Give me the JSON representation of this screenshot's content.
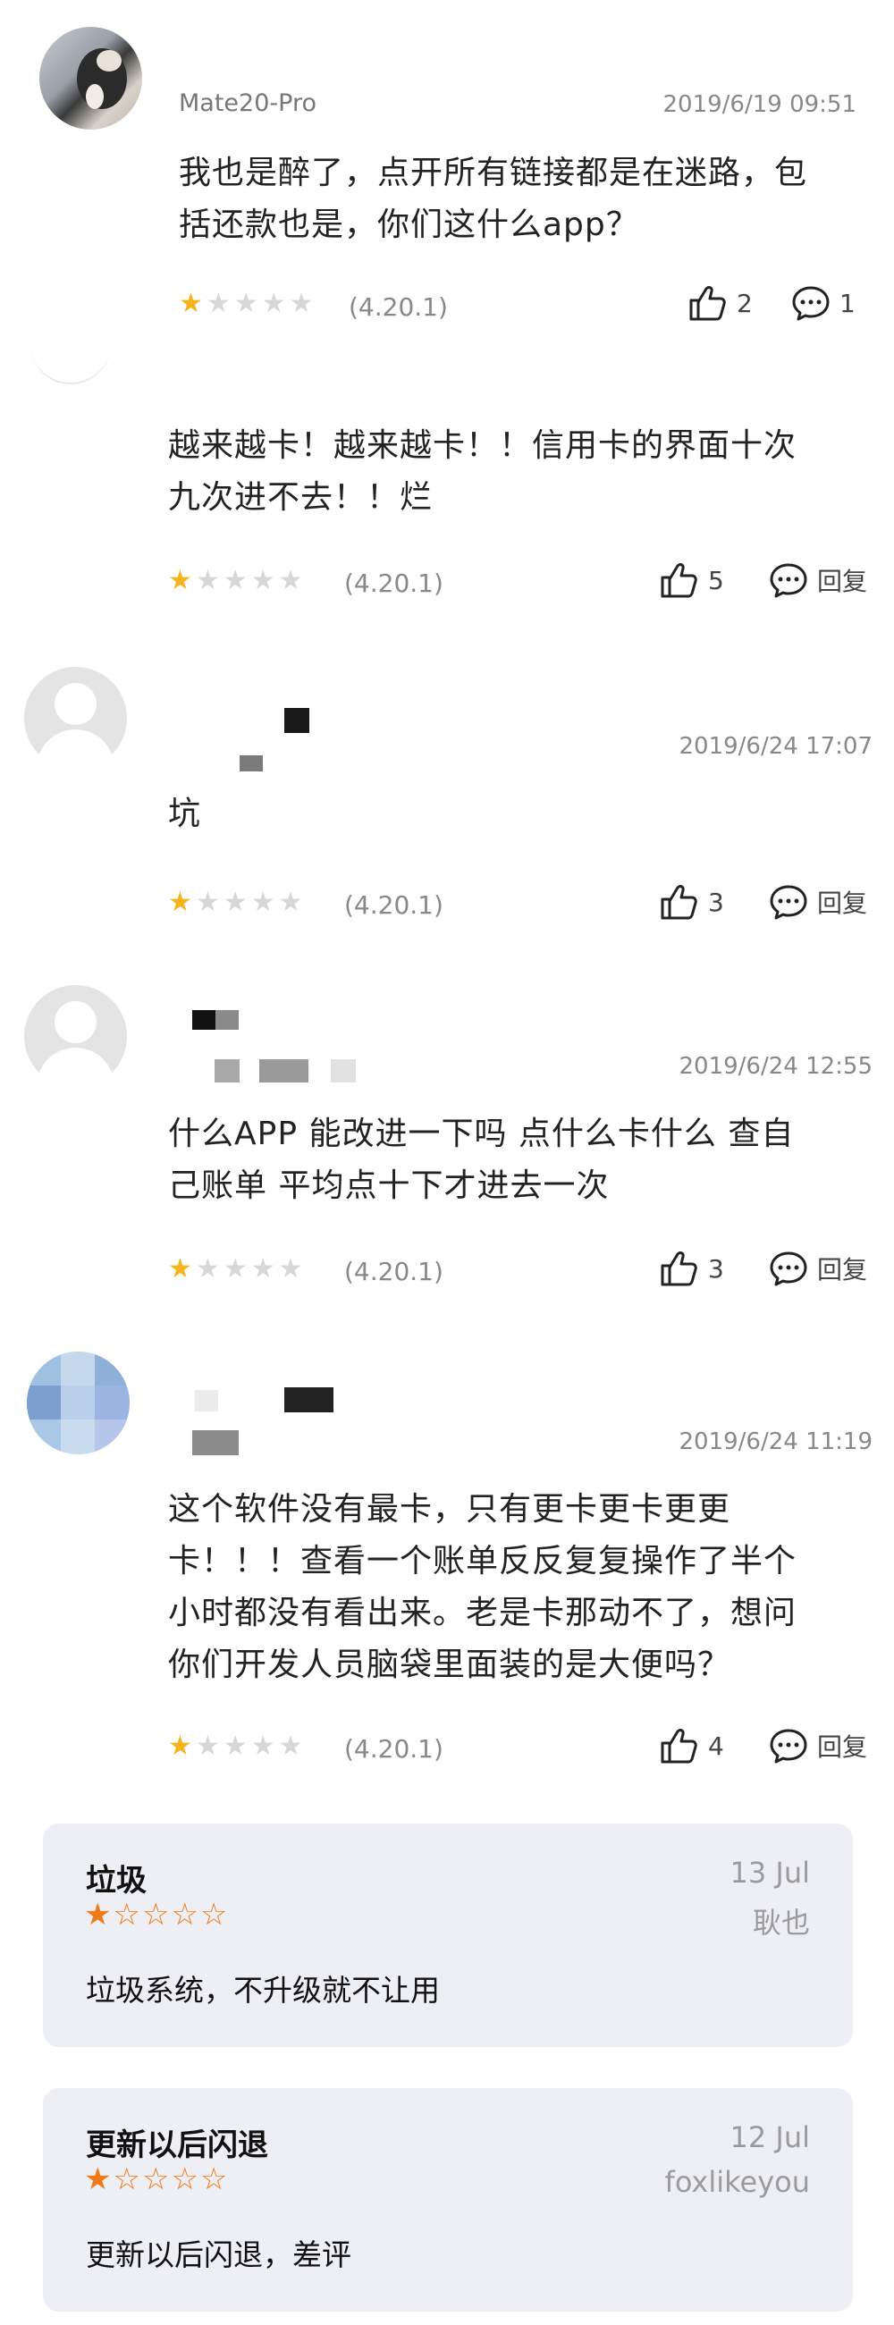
{
  "reviews": [
    {
      "username": "Mate20-Pro",
      "date": "2019/6/19 09:51",
      "content_lines": [
        "我也是醉了，点开所有链接都是在迷路，包",
        "括还款也是，你们这什么app？"
      ],
      "rating": 1,
      "version": "(4.20.1)",
      "likes": "2",
      "comments": "1"
    },
    {
      "username": "",
      "date": "",
      "content_lines": [
        "越来越卡！越来越卡！！信用卡的界面十次",
        "九次进不去！！烂"
      ],
      "rating": 1,
      "version": "(4.20.1)",
      "likes": "5",
      "reply_label": "回复"
    },
    {
      "username": "",
      "date": "2019/6/24 17:07",
      "content_lines": [
        "坑"
      ],
      "rating": 1,
      "version": "(4.20.1)",
      "likes": "3",
      "reply_label": "回复"
    },
    {
      "username": "",
      "date": "2019/6/24 12:55",
      "content_lines": [
        "什么APP  能改进一下吗  点什么卡什么  查自",
        "己账单 平均点十下才进去一次"
      ],
      "rating": 1,
      "version": "(4.20.1)",
      "likes": "3",
      "reply_label": "回复"
    },
    {
      "username": "",
      "date": "2019/6/24 11:19",
      "content_lines": [
        "这个软件没有最卡，只有更卡更卡更更",
        "卡！！！查看一个账单反反复复操作了半个",
        "小时都没有看出来。老是卡那动不了，想问",
        "你们开发人员脑袋里面装的是大便吗？"
      ],
      "rating": 1,
      "version": "(4.20.1)",
      "likes": "4",
      "reply_label": "回复"
    }
  ],
  "cards": [
    {
      "title": "垃圾",
      "date": "13 Jul",
      "author": "耿也",
      "rating": 1,
      "body": "垃圾系统，不升级就不让用"
    },
    {
      "title": "更新以后闪退",
      "date": "12 Jul",
      "author": "foxlikeyou",
      "rating": 1,
      "body": "更新以后闪退，差评"
    }
  ],
  "icons": {
    "like": "thumbs-up-icon",
    "comment": "comment-icon",
    "star": "star-icon"
  },
  "colors": {
    "star_on": "#f5b41b",
    "star_off": "#d7d7d7",
    "card_star": "#f07a17",
    "card_bg": "#eeeef5"
  }
}
